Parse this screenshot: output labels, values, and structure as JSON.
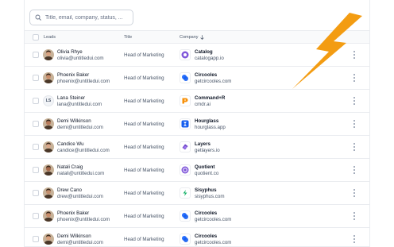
{
  "search": {
    "placeholder": "Title, email, company, status, ..."
  },
  "table": {
    "headers": {
      "leads": "Leads",
      "title": "Title",
      "company": "Company"
    }
  },
  "rows": [
    {
      "name": "Olivia Rhye",
      "email": "olivia@untitledui.com",
      "title": "Head of Marketing",
      "company": "Catalog",
      "url": "catalogapp.io",
      "avatar": "photo-avatar",
      "logo": "catalog-logo-icon"
    },
    {
      "name": "Phoenix Baker",
      "email": "phoenix@untitledui.com",
      "title": "Head of Marketing",
      "company": "Circooles",
      "url": "getcircooles.com",
      "avatar": "photo-avatar",
      "logo": "circooles-logo-icon"
    },
    {
      "name": "Lana Steiner",
      "email": "lana@untitledui.com",
      "title": "Head of Marketing",
      "company": "Command+R",
      "url": "cmdr.ai",
      "avatar": "initials-avatar",
      "initials": "LS",
      "logo": "commandr-logo-icon"
    },
    {
      "name": "Demi Wilkinson",
      "email": "demi@untitledui.com",
      "title": "Head of Marketing",
      "company": "Hourglass",
      "url": "hourglass.app",
      "avatar": "photo-avatar",
      "logo": "hourglass-logo-icon"
    },
    {
      "name": "Candice Wu",
      "email": "candice@untitledui.com",
      "title": "Head of Marketing",
      "company": "Layers",
      "url": "getlayers.io",
      "avatar": "photo-avatar",
      "logo": "layers-logo-icon"
    },
    {
      "name": "Natali Craig",
      "email": "natali@untitledui.com",
      "title": "Head of Marketing",
      "company": "Quotient",
      "url": "quotient.co",
      "avatar": "photo-avatar",
      "logo": "quotient-logo-icon"
    },
    {
      "name": "Drew Cano",
      "email": "drew@untitledui.com",
      "title": "Head of Marketing",
      "company": "Sisyphus",
      "url": "sisyphus.com",
      "avatar": "photo-avatar",
      "logo": "sisyphus-logo-icon"
    },
    {
      "name": "Phoenix Baker",
      "email": "phoenix@untitledui.com",
      "title": "Head of Marketing",
      "company": "Circooles",
      "url": "getcircooles.com",
      "avatar": "photo-avatar",
      "logo": "circooles-logo-icon"
    },
    {
      "name": "Demi Wilkinson",
      "email": "demi@untitledui.com",
      "title": "Head of Marketing",
      "company": "Circooles",
      "url": "getcircooles.com",
      "avatar": "photo-avatar",
      "logo": "circooles-logo-icon"
    }
  ],
  "colors": {
    "accent_bolt": "#f59e0b",
    "border": "#eaecf0",
    "text_primary": "#101828",
    "text_secondary": "#475467"
  }
}
